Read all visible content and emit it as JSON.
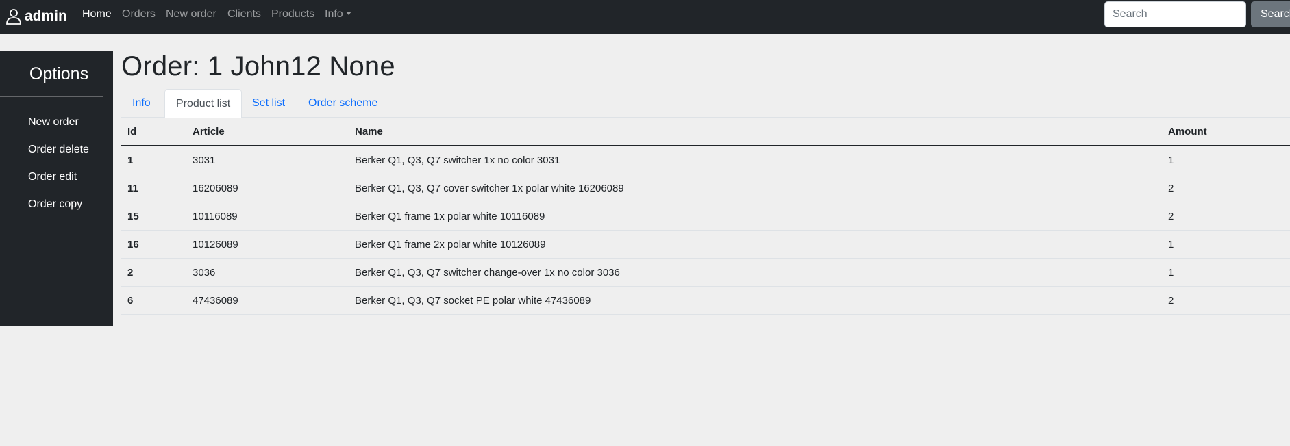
{
  "navbar": {
    "brand": "admin",
    "links": [
      {
        "label": "Home",
        "active": true
      },
      {
        "label": "Orders",
        "active": false
      },
      {
        "label": "New order",
        "active": false
      },
      {
        "label": "Clients",
        "active": false
      },
      {
        "label": "Products",
        "active": false
      },
      {
        "label": "Info",
        "active": false,
        "dropdown": true
      }
    ],
    "search": {
      "placeholder": "Search",
      "value": "",
      "button_label": "Search"
    }
  },
  "sidebar": {
    "title": "Options",
    "items": [
      "New order",
      "Order delete",
      "Order edit",
      "Order copy"
    ]
  },
  "page": {
    "title": "Order: 1 John12 None",
    "tabs": [
      {
        "label": "Info",
        "active": false
      },
      {
        "label": "Product list",
        "active": true
      },
      {
        "label": "Set list",
        "active": false
      },
      {
        "label": "Order scheme",
        "active": false
      }
    ]
  },
  "table": {
    "headers": [
      "Id",
      "Article",
      "Name",
      "Amount"
    ],
    "rows": [
      [
        "1",
        "3031",
        "Berker Q1, Q3, Q7 switcher 1x no color 3031",
        "1"
      ],
      [
        "11",
        "16206089",
        "Berker Q1, Q3, Q7 cover switcher 1x polar white 16206089",
        "2"
      ],
      [
        "15",
        "10116089",
        "Berker Q1 frame 1x polar white 10116089",
        "2"
      ],
      [
        "16",
        "10126089",
        "Berker Q1 frame 2x polar white 10126089",
        "1"
      ],
      [
        "2",
        "3036",
        "Berker Q1, Q3, Q7 switcher change-over 1x no color 3036",
        "1"
      ],
      [
        "6",
        "47436089",
        "Berker Q1, Q3, Q7 socket PE polar white 47436089",
        "2"
      ]
    ]
  },
  "colors": {
    "navbar_bg": "#212529",
    "page_bg": "#efefef",
    "link_blue": "#0d6efd",
    "search_button_bg": "#6c757d"
  },
  "icons": {
    "brand": "user-icon"
  }
}
